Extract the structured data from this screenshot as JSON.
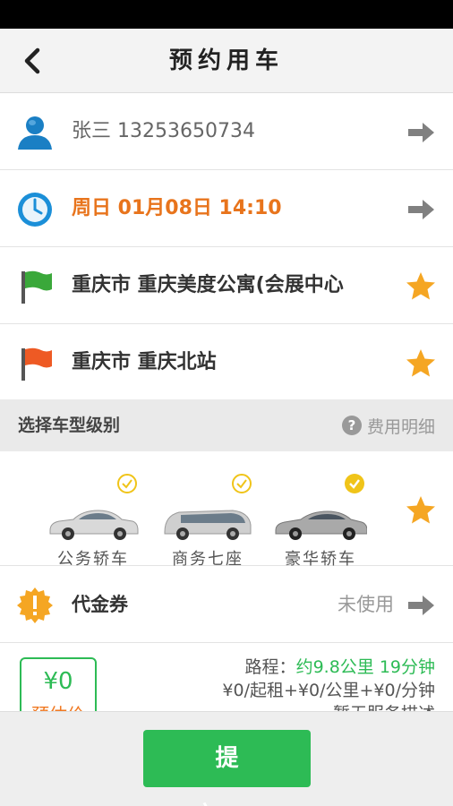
{
  "header": {
    "title": "预约用车"
  },
  "passenger": {
    "text": "张三 13253650734"
  },
  "time": {
    "text": "周日 01月08日 14:10",
    "color": "#e8741c"
  },
  "origin": {
    "text": "重庆市 重庆美度公寓(会展中心"
  },
  "destination": {
    "text": "重庆市 重庆北站"
  },
  "car_section": {
    "title": "选择车型级别",
    "fee_detail": "费用明细"
  },
  "car_types": [
    {
      "label": "公务轿车",
      "selected": false
    },
    {
      "label": "商务七座",
      "selected": false
    },
    {
      "label": "豪华轿车",
      "selected": true
    }
  ],
  "voucher": {
    "label": "代金券",
    "status": "未使用"
  },
  "price": {
    "amount": "¥0",
    "label": "预估价",
    "route_prefix": "路程：",
    "route_value": "约9.8公里 19分钟",
    "rate": "¥0/起租+¥0/公里+¥0/分钟",
    "service_note": "暂无服务描述"
  },
  "submit": {
    "label": "提交"
  },
  "colors": {
    "accent": "#2dbb55",
    "orange": "#e8741c",
    "star": "#f5a623"
  }
}
